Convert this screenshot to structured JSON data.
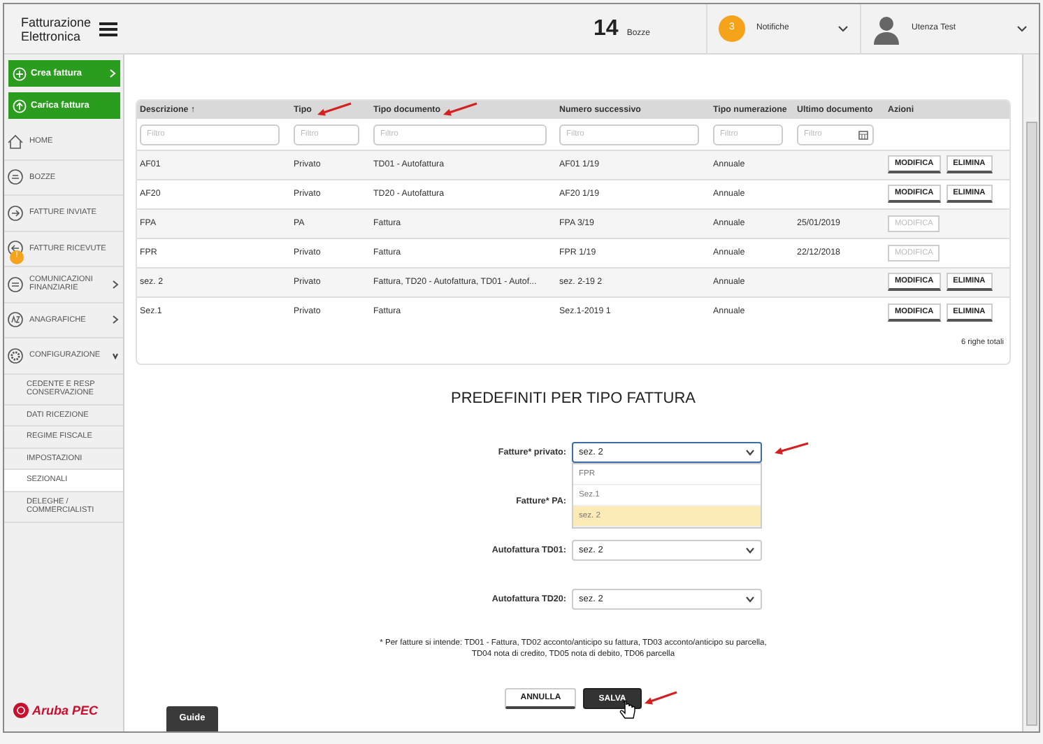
{
  "app": {
    "title": "Fatturazione Elettronica"
  },
  "header": {
    "drafts_count": "14",
    "drafts_label": "Bozze",
    "notifications_count": "3",
    "notifications_label": "Notifiche",
    "user": "Utenza Test"
  },
  "sidebar": {
    "actions": [
      {
        "label": "Crea fattura",
        "expandable": true
      },
      {
        "label": "Carica fattura",
        "expandable": false
      }
    ],
    "items": [
      {
        "label": "HOME"
      },
      {
        "label": "BOZZE"
      },
      {
        "label": "FATTURE INVIATE"
      },
      {
        "label": "FATTURE RICEVUTE",
        "badge": "!"
      },
      {
        "label": "COMUNICAZIONI FINANZIARIE",
        "expanded": false
      },
      {
        "label": "ANAGRAFICHE",
        "expanded": false
      },
      {
        "label": "CONFIGURAZIONE",
        "expanded": true,
        "children": [
          {
            "label": "CEDENTE E RESP CONSERVAZIONE",
            "selected": false
          },
          {
            "label": "DATI RICEZIONE",
            "selected": false
          },
          {
            "label": "REGIME FISCALE",
            "selected": false
          },
          {
            "label": "IMPOSTAZIONI",
            "selected": false
          },
          {
            "label": "SEZIONALI",
            "selected": true
          },
          {
            "label": "DELEGHE / COMMERCIALISTI",
            "selected": false
          }
        ]
      }
    ],
    "logo": "Aruba PEC"
  },
  "table": {
    "columns": [
      {
        "label": "Descrizione",
        "sort_icon": "↑"
      },
      {
        "label": "Tipo"
      },
      {
        "label": "Tipo documento"
      },
      {
        "label": "Numero successivo"
      },
      {
        "label": "Tipo numerazione"
      },
      {
        "label": "Ultimo documento"
      },
      {
        "label": "Azioni"
      }
    ],
    "filters": [
      {
        "placeholder": "Filtro",
        "kind": "text"
      },
      {
        "placeholder": "Filtro",
        "kind": "text"
      },
      {
        "placeholder": "Filtro",
        "kind": "text"
      },
      {
        "placeholder": "Filtro",
        "kind": "text"
      },
      {
        "placeholder": "Filtro",
        "kind": "text"
      },
      {
        "placeholder": "Filtro",
        "kind": "date"
      }
    ],
    "rows": [
      {
        "cells": [
          "AF01",
          "Privato",
          "TD01 - Autofattura",
          "AF01 1/19",
          "Annuale",
          ""
        ],
        "actions": [
          {
            "label": "MODIFICA",
            "disabled": false
          },
          {
            "label": "ELIMINA",
            "disabled": false
          }
        ]
      },
      {
        "cells": [
          "AF20",
          "Privato",
          "TD20 - Autofattura",
          "AF20 1/19",
          "Annuale",
          ""
        ],
        "actions": [
          {
            "label": "MODIFICA",
            "disabled": false
          },
          {
            "label": "ELIMINA",
            "disabled": false
          }
        ]
      },
      {
        "cells": [
          "FPA",
          "PA",
          "Fattura",
          "FPA 3/19",
          "Annuale",
          "25/01/2019"
        ],
        "actions": [
          {
            "label": "MODIFICA",
            "disabled": true
          }
        ]
      },
      {
        "cells": [
          "FPR",
          "Privato",
          "Fattura",
          "FPR 1/19",
          "Annuale",
          "22/12/2018"
        ],
        "actions": [
          {
            "label": "MODIFICA",
            "disabled": true
          }
        ]
      },
      {
        "cells": [
          "sez. 2",
          "Privato",
          "Fattura, TD20 - Autofattura, TD01 - Autof...",
          "sez. 2-19 2",
          "Annuale",
          ""
        ],
        "actions": [
          {
            "label": "MODIFICA",
            "disabled": false
          },
          {
            "label": "ELIMINA",
            "disabled": false
          }
        ]
      },
      {
        "cells": [
          "Sez.1",
          "Privato",
          "Fattura",
          "Sez.1-2019 1",
          "Annuale",
          ""
        ],
        "actions": [
          {
            "label": "MODIFICA",
            "disabled": false
          },
          {
            "label": "ELIMINA",
            "disabled": false
          }
        ]
      }
    ],
    "total": "6 righe totali"
  },
  "defaults": {
    "title": "PREDEFINITI PER TIPO FATTURA",
    "fields": [
      {
        "label": "Fatture* privato:",
        "value": "sez. 2",
        "open": true,
        "options": [
          {
            "label": "FPR",
            "selected": false
          },
          {
            "label": "Sez.1",
            "selected": false
          },
          {
            "label": "sez. 2",
            "selected": true
          }
        ]
      },
      {
        "label": "Fatture* PA:"
      },
      {
        "label": "Autofattura TD01:",
        "value": "sez. 2"
      },
      {
        "label": "Autofattura TD20:",
        "value": "sez. 2"
      }
    ],
    "note": "* Per fatture si intende: TD01 - Fattura, TD02 acconto/anticipo su fattura, TD03 acconto/anticipo su parcella, TD04 nota di credito, TD05 nota di debito, TD06 parcella",
    "buttons": [
      {
        "label": "ANNULLA",
        "kind": "secondary"
      },
      {
        "label": "SALVA",
        "kind": "primary"
      }
    ]
  },
  "guide": "Guide"
}
